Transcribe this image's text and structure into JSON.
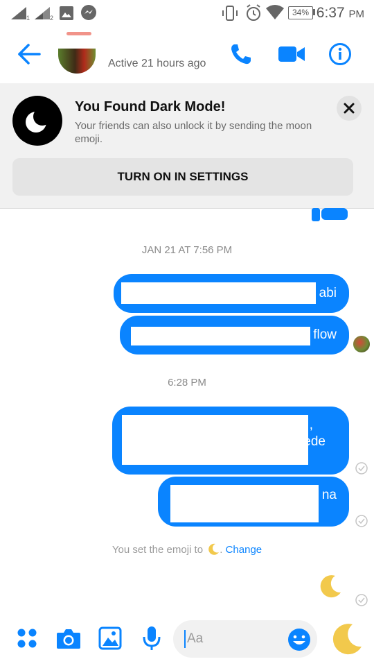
{
  "status_bar": {
    "battery": "34%",
    "time": "6:37",
    "ampm": "PM",
    "sim1": "1",
    "sim2": "2"
  },
  "header": {
    "active_status": "Active 21 hours ago"
  },
  "banner": {
    "title": "You Found Dark Mode!",
    "subtitle": "Your friends can also unlock it by sending the moon emoji.",
    "button_label": "TURN ON IN SETTINGS"
  },
  "messages": {
    "stamp1": "JAN 21 AT 7:56 PM",
    "msg1_tail": "abi",
    "msg2_tail": "flow",
    "stamp2": "6:28 PM",
    "msg3_tail_line1": ",",
    "msg3_tail_line2": "ede",
    "msg4_tail": "na",
    "emoji_note": "You set the emoji to",
    "emoji_note_link": "Change"
  },
  "composer": {
    "placeholder": "Aa"
  },
  "colors": {
    "accent": "#0a84ff",
    "banner_bg": "#f1f1f1",
    "moon": "#f2c94c"
  }
}
